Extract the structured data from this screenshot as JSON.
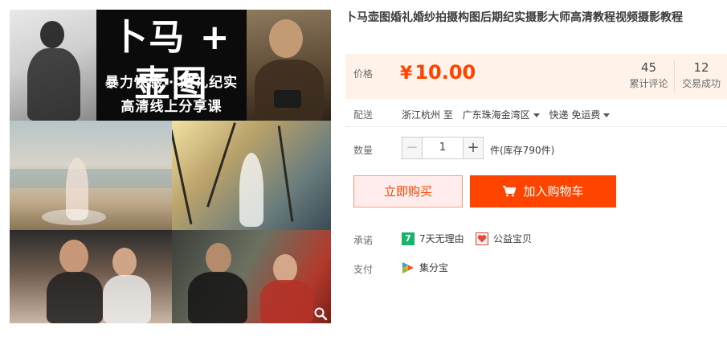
{
  "product": {
    "title": "卜马壶图婚礼婚纱拍摄构图后期纪实摄影大师高清教程视频摄影教程"
  },
  "gallery": {
    "banner_title": "卜马 + 壶图",
    "banner_line1": "暴力快感 · 婚礼纪实",
    "banner_line2": "高清线上分享课",
    "zoom_icon": "magnifier-icon"
  },
  "price": {
    "label": "价格",
    "currency": "¥",
    "amount": "10.00",
    "reviews_count": "45",
    "reviews_caption": "累计评论",
    "sales_count": "12",
    "sales_caption": "交易成功"
  },
  "delivery": {
    "label": "配送",
    "from": "浙江杭州 至",
    "to": "广东珠海金湾区",
    "method": "快递 免运费"
  },
  "quantity": {
    "label": "数量",
    "value": "1",
    "minus": "−",
    "plus": "+",
    "stock": "件(库存790件)"
  },
  "actions": {
    "buy_now": "立即购买",
    "add_to_cart": "加入购物车",
    "cart_icon": "shopping-cart-icon"
  },
  "promise": {
    "label": "承诺",
    "item1_badge": "7",
    "item1": "7天无理由",
    "item2": "公益宝贝"
  },
  "payment": {
    "label": "支付",
    "item": "集分宝"
  },
  "colors": {
    "accent": "#ff4400",
    "price_bg": "#fff2e8",
    "buy_now_bg": "#ffeded",
    "seven_day_badge": "#1bb36b"
  }
}
